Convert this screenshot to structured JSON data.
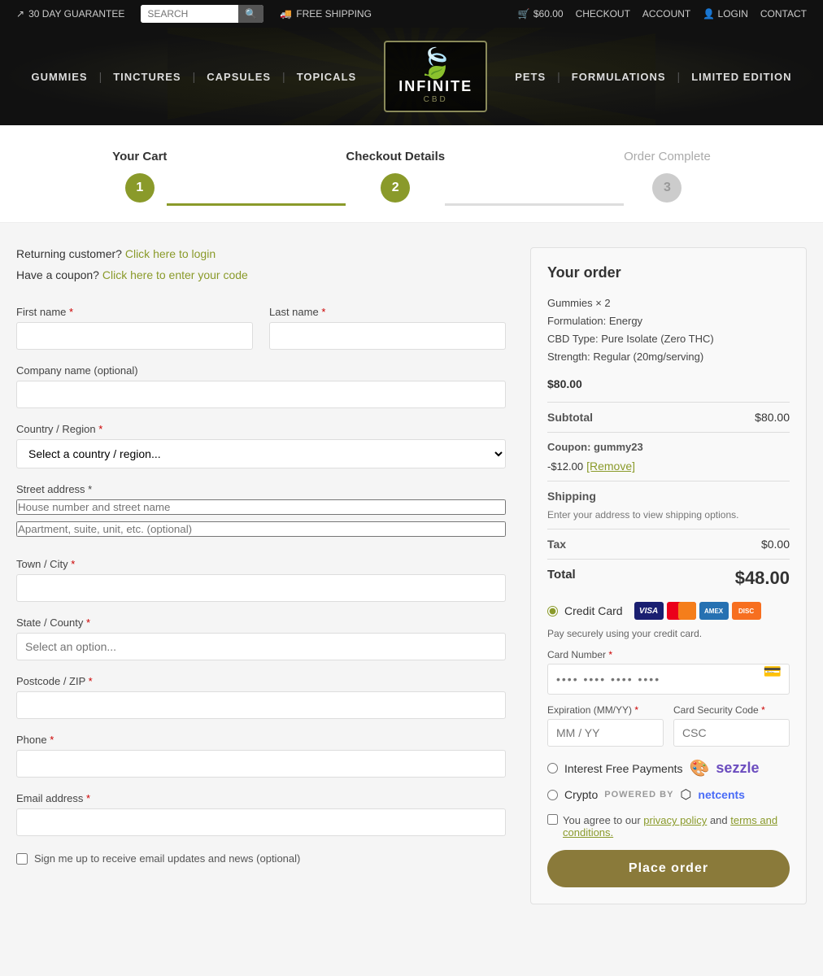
{
  "topbar": {
    "guarantee": "30 DAY GUARANTEE",
    "search_placeholder": "SEARCH",
    "free_shipping": "FREE SHIPPING",
    "cart_label": "$60.00",
    "checkout_link": "CHECKOUT",
    "account_link": "ACCOUNT",
    "login_link": "LOGIN",
    "contact_link": "CONTACT"
  },
  "nav": {
    "logo_text": "iNFiNiTe",
    "logo_sub": "CBD",
    "items": [
      {
        "label": "GUMMIES"
      },
      {
        "label": "TINCTURES"
      },
      {
        "label": "CAPSULES"
      },
      {
        "label": "TOPICALS"
      },
      {
        "label": "PETS"
      },
      {
        "label": "FORMULATIONS"
      },
      {
        "label": "LIMITED EDITION"
      }
    ]
  },
  "steps": {
    "step1_label": "Your Cart",
    "step1_num": "1",
    "step2_label": "Checkout Details",
    "step2_num": "2",
    "step3_label": "Order Complete",
    "step3_num": "3"
  },
  "form": {
    "returning_text": "Returning customer?",
    "returning_link": "Click here to login",
    "coupon_text": "Have a coupon?",
    "coupon_link": "Click here to enter your code",
    "first_name_label": "First name",
    "last_name_label": "Last name",
    "company_label": "Company name (optional)",
    "country_label": "Country / Region",
    "country_placeholder": "Select a country / region...",
    "street_label": "Street address",
    "street_placeholder": "House number and street name",
    "apt_placeholder": "Apartment, suite, unit, etc. (optional)",
    "city_label": "Town / City",
    "state_label": "State / County",
    "state_placeholder": "Select an option...",
    "postcode_label": "Postcode / ZIP",
    "phone_label": "Phone",
    "email_label": "Email address",
    "signup_label": "Sign me up to receive email updates and news (optional)"
  },
  "order": {
    "title": "Your order",
    "product": "Gummies × 2",
    "formulation": "Formulation: Energy",
    "cbd_type": "CBD Type: Pure Isolate (Zero THC)",
    "strength": "Strength: Regular (20mg/serving)",
    "product_price": "$80.00",
    "subtotal_label": "Subtotal",
    "subtotal_value": "$80.00",
    "coupon_label": "Coupon: gummy23",
    "coupon_discount": "-$12.00",
    "remove_label": "[Remove]",
    "shipping_label": "Shipping",
    "shipping_note": "Enter your address to view shipping options.",
    "tax_label": "Tax",
    "tax_value": "$0.00",
    "total_label": "Total",
    "total_value": "$48.00"
  },
  "payment": {
    "credit_card_label": "Credit Card",
    "pay_secure_note": "Pay securely using your credit card.",
    "card_number_label": "Card Number",
    "card_number_placeholder": "•••• •••• •••• ••••",
    "expiry_label": "Expiration (MM/YY)",
    "expiry_placeholder": "MM / YY",
    "csc_label": "Card Security Code",
    "csc_placeholder": "CSC",
    "sezzle_label": "Interest Free Payments",
    "crypto_label": "Crypto",
    "powered_by": "POWERED BY",
    "netcents_label": "netcents",
    "agree_text": "You agree to our",
    "privacy_policy_link": "privacy policy",
    "and_text": "and",
    "terms_link": "terms and conditions.",
    "place_order_label": "Place order"
  }
}
